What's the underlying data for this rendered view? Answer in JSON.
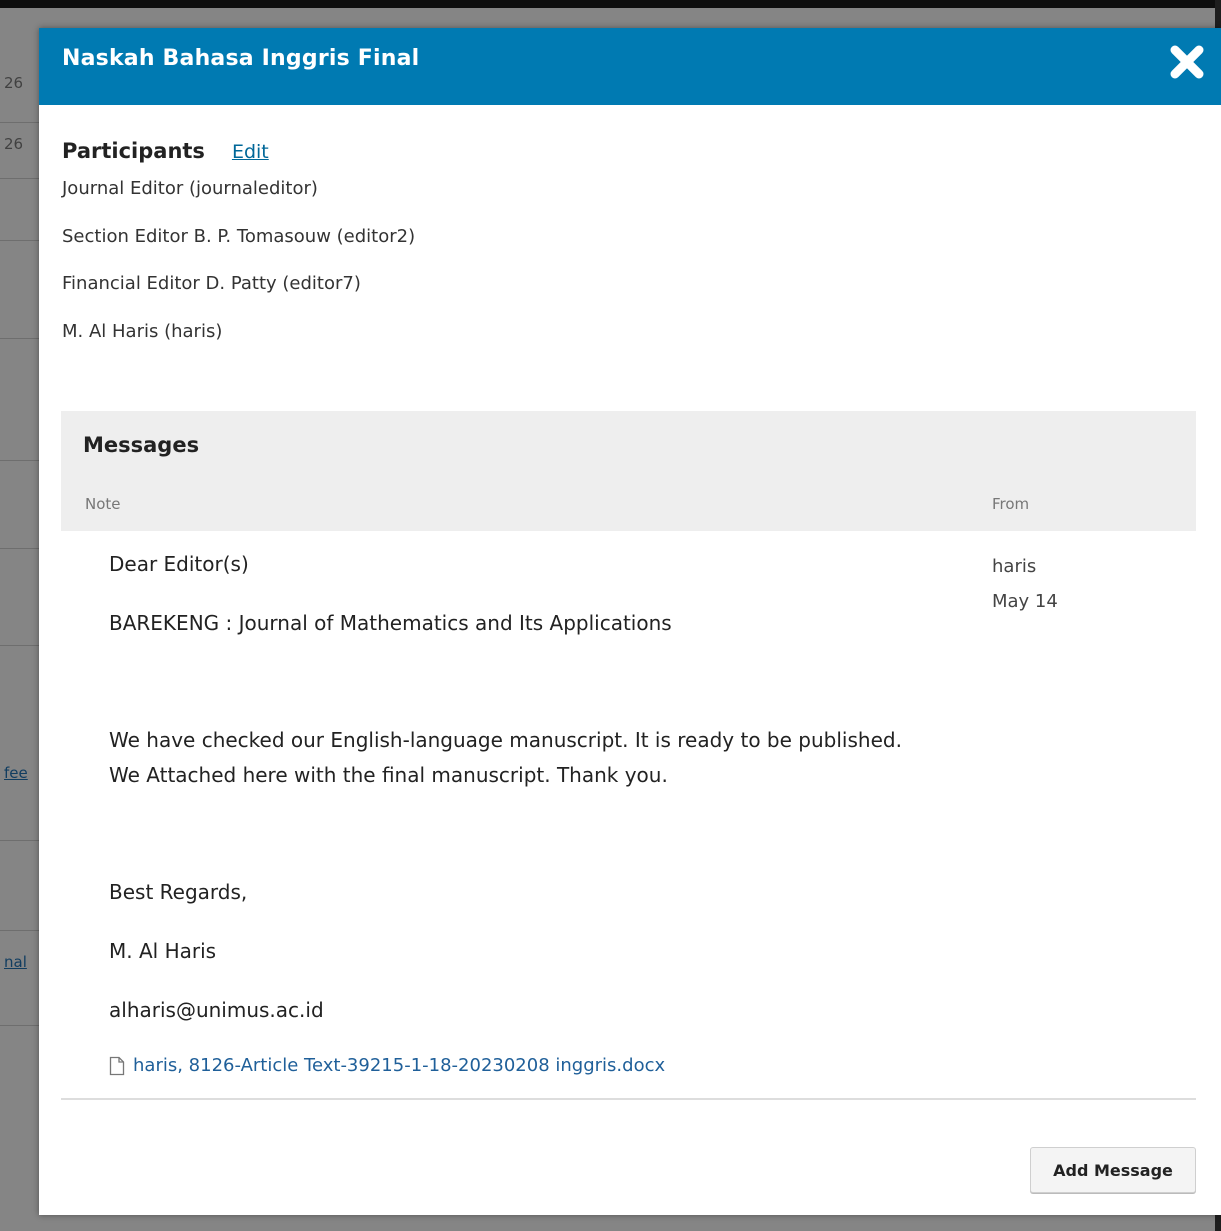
{
  "modal": {
    "title": "Naskah Bahasa Inggris Final",
    "close_icon": "close-icon"
  },
  "participants": {
    "title": "Participants",
    "edit_label": "Edit",
    "items": [
      "Journal Editor (journaleditor)",
      "Section Editor B. P. Tomasouw (editor2)",
      "Financial Editor D. Patty (editor7)",
      "M. Al Haris (haris)"
    ]
  },
  "messages": {
    "title": "Messages",
    "col_note": "Note",
    "col_from": "From",
    "message": {
      "greeting": "Dear Editor(s)",
      "journal": "BAREKENG : Journal of Mathematics and Its Applications",
      "body": "We have checked our English-language manuscript. It is ready to be published. We Attached here with the final manuscript. Thank you.",
      "closing": "Best Regards,",
      "signature": "M. Al Haris",
      "email": "alharis@unimus.ac.id",
      "attachment": "haris, 8126-Article Text-39215-1-18-20230208 inggris.docx",
      "from_user": "haris",
      "from_date": "May 14"
    }
  },
  "actions": {
    "add_message_label": "Add Message"
  },
  "background": {
    "fragments": [
      "26",
      "26",
      "fee",
      "nal"
    ]
  },
  "colors": {
    "header": "#007ab2",
    "link": "#006798",
    "panel_head": "#eeeeee"
  }
}
